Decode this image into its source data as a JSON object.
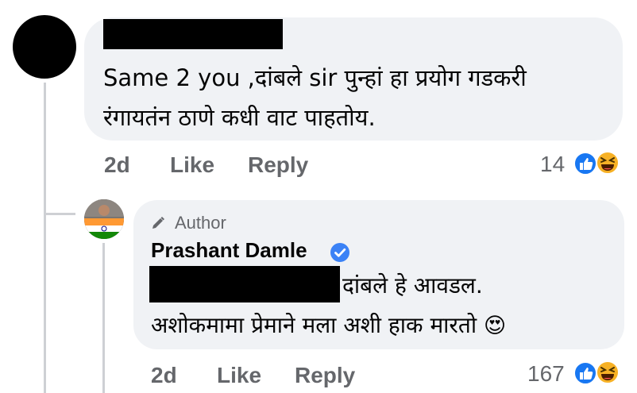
{
  "comment": {
    "text_line1": "Same 2 you ,दांबले sir पुन्हां हा प्रयोग गडकरी",
    "text_line2": "रंगायतंन ठाणे कधी वाट पाहतोय.",
    "time": "2d",
    "like_label": "Like",
    "reply_label": "Reply",
    "reaction_count": "14"
  },
  "reply": {
    "badge": "Author",
    "author_name": "Prashant Damle",
    "text_line1": "दांबले हे आवडल.",
    "text_line2": "अशोकमामा प्रेमाने मला अशी हाक मारतो",
    "emoji": "😍",
    "time": "2d",
    "like_label": "Like",
    "reply_label": "Reply",
    "reaction_count": "167"
  },
  "colors": {
    "bubble_bg": "#f0f2f5",
    "meta_gray": "#65676b",
    "like_blue": "#1877f2",
    "haha_yellow": "#f7b125",
    "verified_blue": "#3b82f6",
    "thread_line": "#ced0d4"
  },
  "icons": [
    "pencil-icon",
    "verified-badge-icon",
    "like-reaction-icon",
    "haha-reaction-icon"
  ]
}
